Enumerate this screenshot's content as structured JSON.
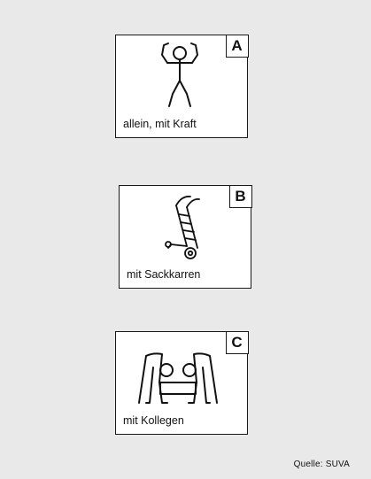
{
  "panels": [
    {
      "letter": "A",
      "caption": "allein, mit Kraft",
      "icon": "strong-person-icon"
    },
    {
      "letter": "B",
      "caption": "mit Sackkarren",
      "icon": "hand-truck-icon"
    },
    {
      "letter": "C",
      "caption": "mit Kollegen",
      "icon": "two-people-carrying-icon"
    }
  ],
  "source": "Quelle: SUVA"
}
